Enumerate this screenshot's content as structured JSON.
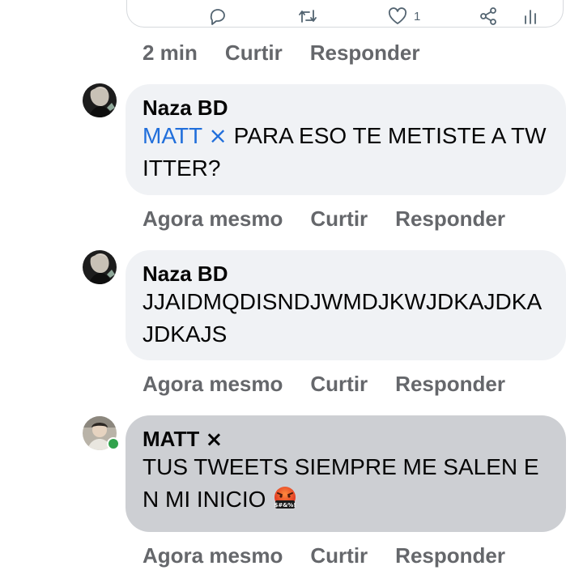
{
  "embed": {
    "actions": [
      {
        "icon": "reply-icon"
      },
      {
        "icon": "retweet-icon"
      },
      {
        "icon": "like-icon",
        "count": "1"
      },
      {
        "icon": "share-icon"
      },
      {
        "icon": "analytics-icon"
      }
    ],
    "meta": {
      "time": "2 min",
      "like": "Curtir",
      "reply": "Responder"
    }
  },
  "comments": [
    {
      "author": "Naza BD",
      "mention": "MATT ⨯",
      "text": " PARA ESO TE METISTE A TWITTER?",
      "meta": {
        "time": "Agora mesmo",
        "like": "Curtir",
        "reply": "Responder"
      }
    },
    {
      "author": "Naza BD",
      "text": "JJAIDMQDISNDJWMDJKWJDKAJDKAJDKAJS",
      "meta": {
        "time": "Agora mesmo",
        "like": "Curtir",
        "reply": "Responder"
      }
    },
    {
      "author": "MATT ⨯",
      "text": "TUS TWEETS SIEMPRE ME SALEN EN MI INICIO ",
      "emoji": "face-with-symbols-on-mouth",
      "online": true,
      "meta": {
        "time": "Agora mesmo",
        "like": "Curtir",
        "reply": "Responder"
      }
    }
  ],
  "colors": {
    "mention": "#216fdb",
    "meta_gray": "#65676b",
    "bubble_light": "#f0f2f5",
    "bubble_dark": "#cdcfd3",
    "online": "#31a24c"
  }
}
